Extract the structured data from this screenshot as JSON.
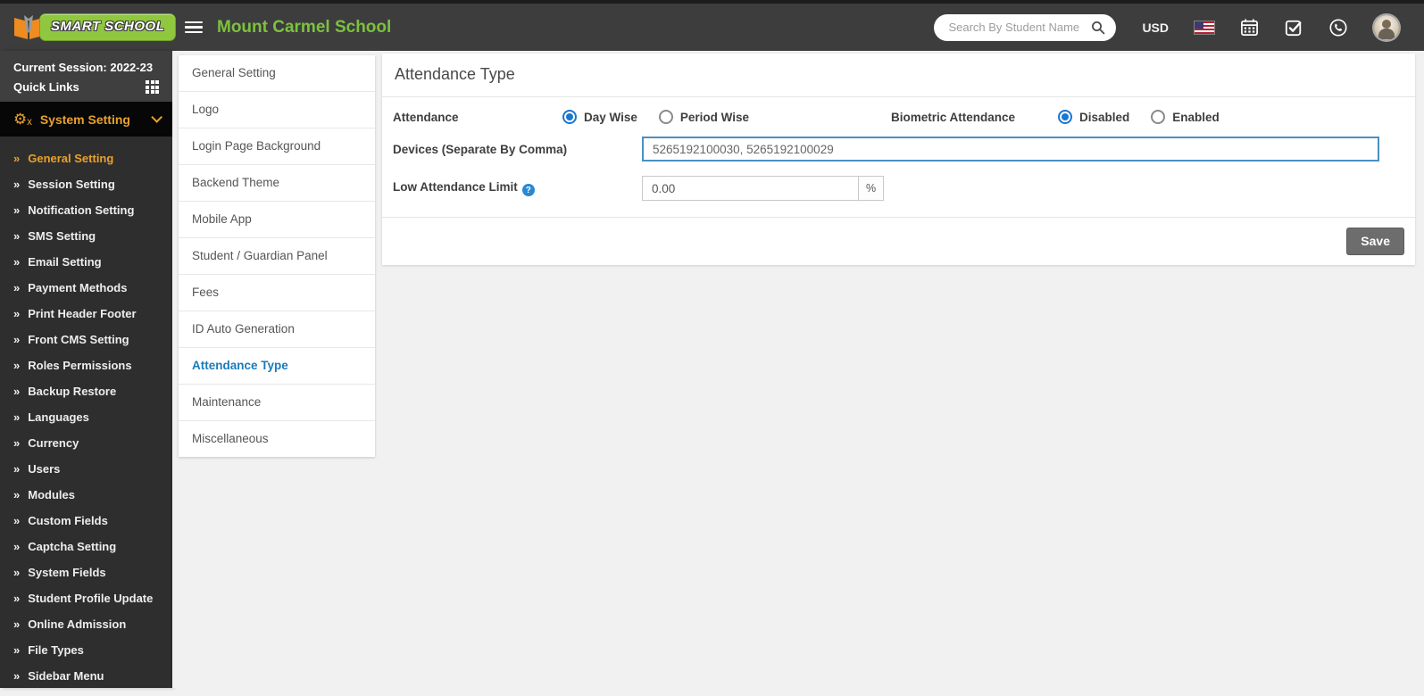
{
  "header": {
    "brand": "SMART SCHOOL",
    "school_name": "Mount Carmel School",
    "search_placeholder": "Search By Student Name",
    "currency_label": "USD"
  },
  "sidebar": {
    "current_session": "Current Session: 2022-23",
    "quick_links": "Quick Links",
    "menu_title": "System Setting",
    "items": [
      {
        "label": "General Setting",
        "active": true
      },
      {
        "label": "Session Setting"
      },
      {
        "label": "Notification Setting"
      },
      {
        "label": "SMS Setting"
      },
      {
        "label": "Email Setting"
      },
      {
        "label": "Payment Methods"
      },
      {
        "label": "Print Header Footer"
      },
      {
        "label": "Front CMS Setting"
      },
      {
        "label": "Roles Permissions"
      },
      {
        "label": "Backup Restore"
      },
      {
        "label": "Languages"
      },
      {
        "label": "Currency"
      },
      {
        "label": "Users"
      },
      {
        "label": "Modules"
      },
      {
        "label": "Custom Fields"
      },
      {
        "label": "Captcha Setting"
      },
      {
        "label": "System Fields"
      },
      {
        "label": "Student Profile Update"
      },
      {
        "label": "Online Admission"
      },
      {
        "label": "File Types"
      },
      {
        "label": "Sidebar Menu"
      }
    ]
  },
  "settings_menu": {
    "items": [
      {
        "label": "General Setting"
      },
      {
        "label": "Logo"
      },
      {
        "label": "Login Page Background"
      },
      {
        "label": "Backend Theme"
      },
      {
        "label": "Mobile App"
      },
      {
        "label": "Student / Guardian Panel"
      },
      {
        "label": "Fees"
      },
      {
        "label": "ID Auto Generation"
      },
      {
        "label": "Attendance Type",
        "active": true
      },
      {
        "label": "Maintenance"
      },
      {
        "label": "Miscellaneous"
      }
    ]
  },
  "main": {
    "title": "Attendance Type",
    "attendance": {
      "label": "Attendance",
      "options": [
        "Day Wise",
        "Period Wise"
      ],
      "selected": "Day Wise"
    },
    "biometric": {
      "label": "Biometric Attendance",
      "options": [
        "Disabled",
        "Enabled"
      ],
      "selected": "Disabled"
    },
    "devices": {
      "label": "Devices (Separate By Comma)",
      "value": "5265192100030, 5265192100029"
    },
    "low_attendance_limit": {
      "label": "Low Attendance Limit",
      "help": "?",
      "value": "0.00",
      "suffix": "%"
    },
    "save_label": "Save"
  },
  "colors": {
    "header_bg": "#3d3d3d",
    "sidebar_bg": "#2e2e2e",
    "accent_orange": "#e9a12d",
    "brand_green": "#8fc73e",
    "title_green": "#7cc13f",
    "active_link_blue": "#1a7bb9",
    "radio_blue": "#1976d2",
    "focus_border_blue": "#4a90c2",
    "save_gray": "#6d6d6d"
  }
}
